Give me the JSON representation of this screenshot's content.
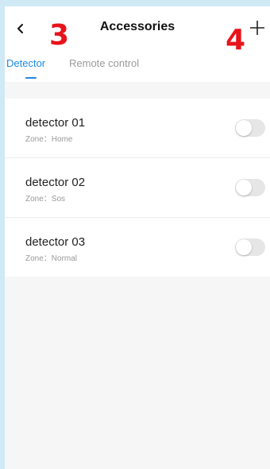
{
  "header": {
    "title": "Accessories",
    "back_icon": "chevron-left-icon",
    "add_icon": "plus-icon"
  },
  "annotations": {
    "marker_3": "3",
    "marker_4": "4"
  },
  "tabs": [
    {
      "label": "Detector",
      "active": true
    },
    {
      "label": "Remote control",
      "active": false
    }
  ],
  "detectors": [
    {
      "name": "detector 01",
      "zone": "Zone：Home",
      "enabled": false
    },
    {
      "name": "detector 02",
      "zone": "Zone：Sos",
      "enabled": false
    },
    {
      "name": "detector 03",
      "zone": "Zone：Normal",
      "enabled": false
    }
  ],
  "colors": {
    "accent": "#1e88e5",
    "annotation": "#e8141c",
    "background": "#f6f6f6"
  }
}
